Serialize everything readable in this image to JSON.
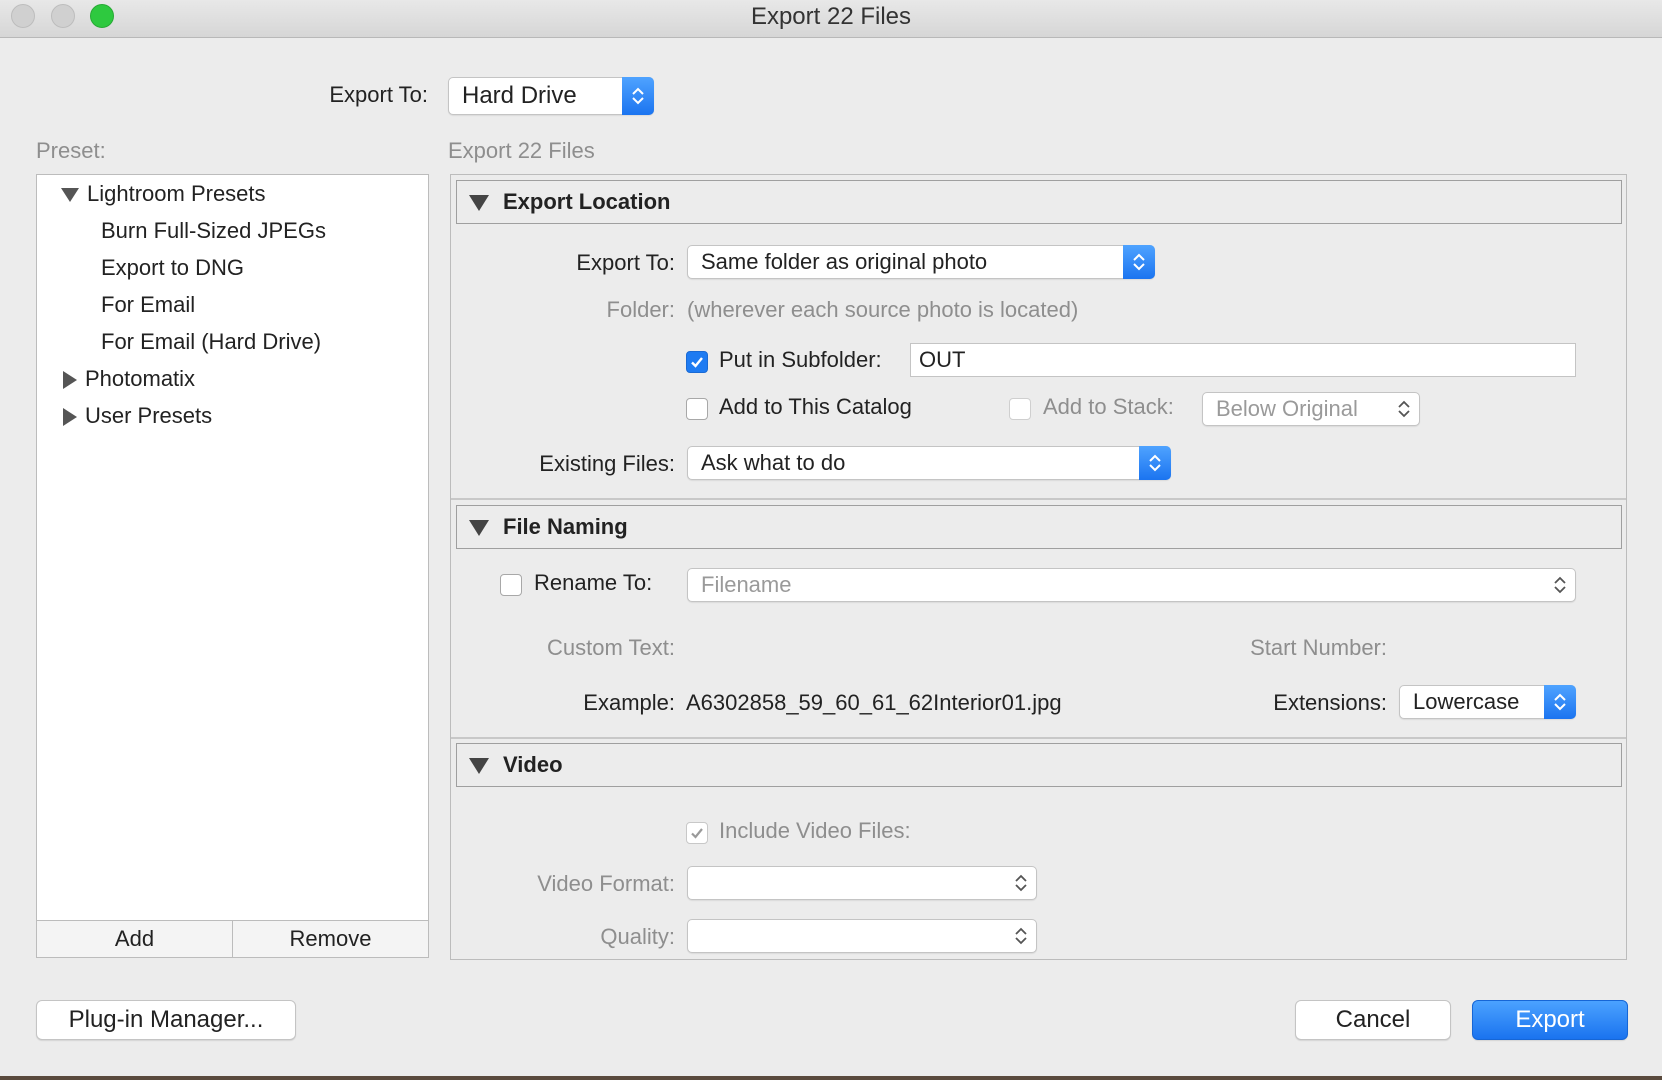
{
  "window": {
    "title": "Export 22 Files"
  },
  "top": {
    "export_to_label": "Export To:",
    "export_to_value": "Hard Drive"
  },
  "preset": {
    "label": "Preset:",
    "groups": [
      {
        "label": "Lightroom Presets",
        "expanded": true,
        "items": [
          "Burn Full-Sized JPEGs",
          "Export to DNG",
          "For Email",
          "For Email (Hard Drive)"
        ]
      },
      {
        "label": "Photomatix",
        "expanded": false
      },
      {
        "label": "User Presets",
        "expanded": false
      }
    ],
    "add_label": "Add",
    "remove_label": "Remove"
  },
  "main": {
    "heading": "Export 22 Files",
    "export_location": {
      "title": "Export Location",
      "export_to_label": "Export To:",
      "export_to_value": "Same folder as original photo",
      "folder_label": "Folder:",
      "folder_value": "(wherever each source photo is located)",
      "subfolder_label": "Put in Subfolder:",
      "subfolder_checked": true,
      "subfolder_value": "OUT",
      "add_catalog_label": "Add to This Catalog",
      "add_catalog_checked": false,
      "add_stack_label": "Add to Stack:",
      "add_stack_value": "Below Original",
      "existing_files_label": "Existing Files:",
      "existing_files_value": "Ask what to do"
    },
    "file_naming": {
      "title": "File Naming",
      "rename_label": "Rename To:",
      "rename_checked": false,
      "rename_value": "Filename",
      "custom_text_label": "Custom Text:",
      "start_number_label": "Start Number:",
      "example_label": "Example:",
      "example_value": "A6302858_59_60_61_62Interior01.jpg",
      "extensions_label": "Extensions:",
      "extensions_value": "Lowercase"
    },
    "video": {
      "title": "Video",
      "include_label": "Include Video Files:",
      "include_checked": true,
      "format_label": "Video Format:",
      "quality_label": "Quality:"
    }
  },
  "footer": {
    "plugin_manager_label": "Plug-in Manager...",
    "cancel_label": "Cancel",
    "export_label": "Export"
  },
  "colors": {
    "accent": "#1e7bf2",
    "maximize": "#2ec93f"
  }
}
